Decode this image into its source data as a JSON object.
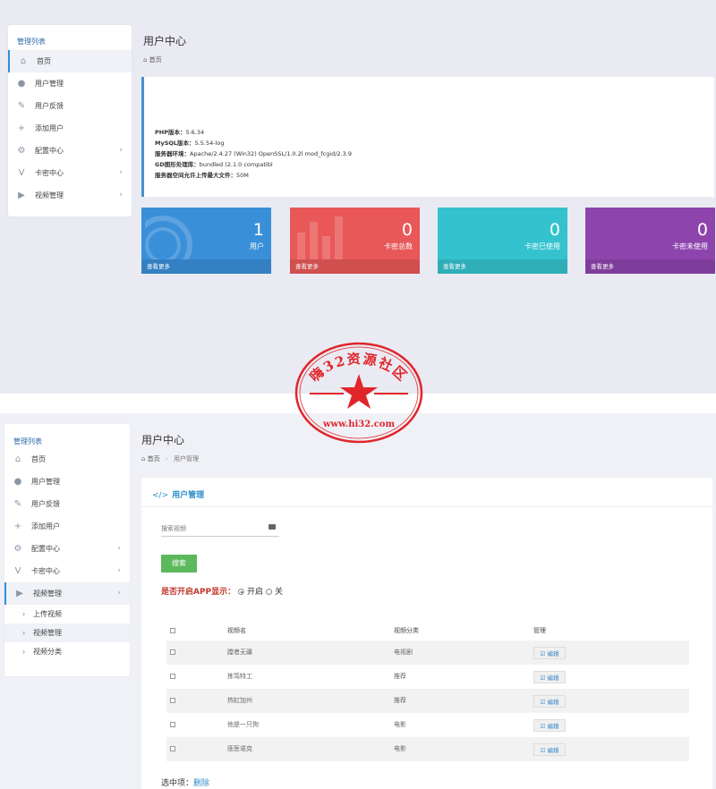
{
  "top": {
    "sidebar": {
      "header": "管理列表",
      "items": [
        {
          "label": "首页",
          "icon": "home-icon",
          "glyph": "⌂",
          "chevron": ""
        },
        {
          "label": "用户管理",
          "icon": "user-icon",
          "glyph": "●",
          "chevron": ""
        },
        {
          "label": "用户反馈",
          "icon": "edit-icon",
          "glyph": "✎",
          "chevron": ""
        },
        {
          "label": "添加用户",
          "icon": "user-add-icon",
          "glyph": "+",
          "chevron": ""
        },
        {
          "label": "配置中心",
          "icon": "gear-icon",
          "glyph": "⚙",
          "chevron": "›"
        },
        {
          "label": "卡密中心",
          "icon": "v-icon",
          "glyph": "V",
          "chevron": "›"
        },
        {
          "label": "视频管理",
          "icon": "play-icon",
          "glyph": "▶",
          "chevron": "›"
        }
      ]
    },
    "page_title": "用户中心",
    "breadcrumb_home": "首页",
    "server_info": {
      "php_label": "PHP版本：",
      "php_value": "5.6.34",
      "mysql_label": "MySQL版本：",
      "mysql_value": "5.5.54-log",
      "env_label": "服务器环境：",
      "env_value": "Apache/2.4.27 (Win32) OpenSSL/1.0.2l mod_fcgid/2.3.9",
      "gd_label": "GD图形处理库：",
      "gd_value": "bundled (2.1.0 compatibl",
      "upload_label": "服务器空间允许上传最大文件：",
      "upload_value": "50M"
    },
    "stats": [
      {
        "value": "1",
        "label": "用户",
        "more": "查看更多",
        "color": "#3a8fd9"
      },
      {
        "value": "0",
        "label": "卡密总数",
        "more": "查看更多",
        "color": "#e85858"
      },
      {
        "value": "0",
        "label": "卡密已使用",
        "more": "查看更多",
        "color": "#35c2cf"
      },
      {
        "value": "0",
        "label": "卡密未使用",
        "more": "查看更多",
        "color": "#8e44ad"
      }
    ]
  },
  "bottom": {
    "sidebar": {
      "header": "管理列表",
      "items": [
        {
          "label": "首页",
          "icon": "home-icon",
          "glyph": "⌂",
          "chevron": ""
        },
        {
          "label": "用户管理",
          "icon": "user-icon",
          "glyph": "●",
          "chevron": ""
        },
        {
          "label": "用户反馈",
          "icon": "edit-icon",
          "glyph": "✎",
          "chevron": ""
        },
        {
          "label": "添加用户",
          "icon": "user-add-icon",
          "glyph": "+",
          "chevron": ""
        },
        {
          "label": "配置中心",
          "icon": "gear-icon",
          "glyph": "⚙",
          "chevron": "›"
        },
        {
          "label": "卡密中心",
          "icon": "v-icon",
          "glyph": "V",
          "chevron": "›"
        },
        {
          "label": "视频管理",
          "icon": "play-icon",
          "glyph": "▶",
          "chevron": "›"
        }
      ],
      "subitems": [
        {
          "label": "上传视频",
          "arrow": "›"
        },
        {
          "label": "视频管理",
          "arrow": "›"
        },
        {
          "label": "视频分类",
          "arrow": "›"
        }
      ]
    },
    "page_title": "用户中心",
    "breadcrumb_home": "首页",
    "breadcrumb_sep": "›",
    "breadcrumb_current": "用户管理",
    "card": {
      "title_icon": "</>",
      "title": "用户管理",
      "search_placeholder": "搜索视频",
      "search_button": "搜索",
      "app_question": "是否开启APP显示：",
      "app_on": "开启",
      "app_off": "关",
      "table": {
        "headers": [
          "视频名",
          "视频分类",
          "管理"
        ],
        "rows": [
          {
            "name": "蹚者无疆",
            "category": "电视剧",
            "action": "☑ 编辑"
          },
          {
            "name": "拣笃特工",
            "category": "推荐",
            "action": "☑ 编辑"
          },
          {
            "name": "热缸加州",
            "category": "推荐",
            "action": "☑ 编辑"
          },
          {
            "name": "他是一只狗",
            "category": "电影",
            "action": "☑ 编辑"
          },
          {
            "name": "匪医诺克",
            "category": "电影",
            "action": "☑ 编辑"
          }
        ]
      },
      "footer_label": "选中项：",
      "footer_delete": "删除"
    }
  },
  "watermark": {
    "top_text": "嗨32资源社区",
    "url": "www.hi32.com",
    "color": "#e0262b"
  }
}
